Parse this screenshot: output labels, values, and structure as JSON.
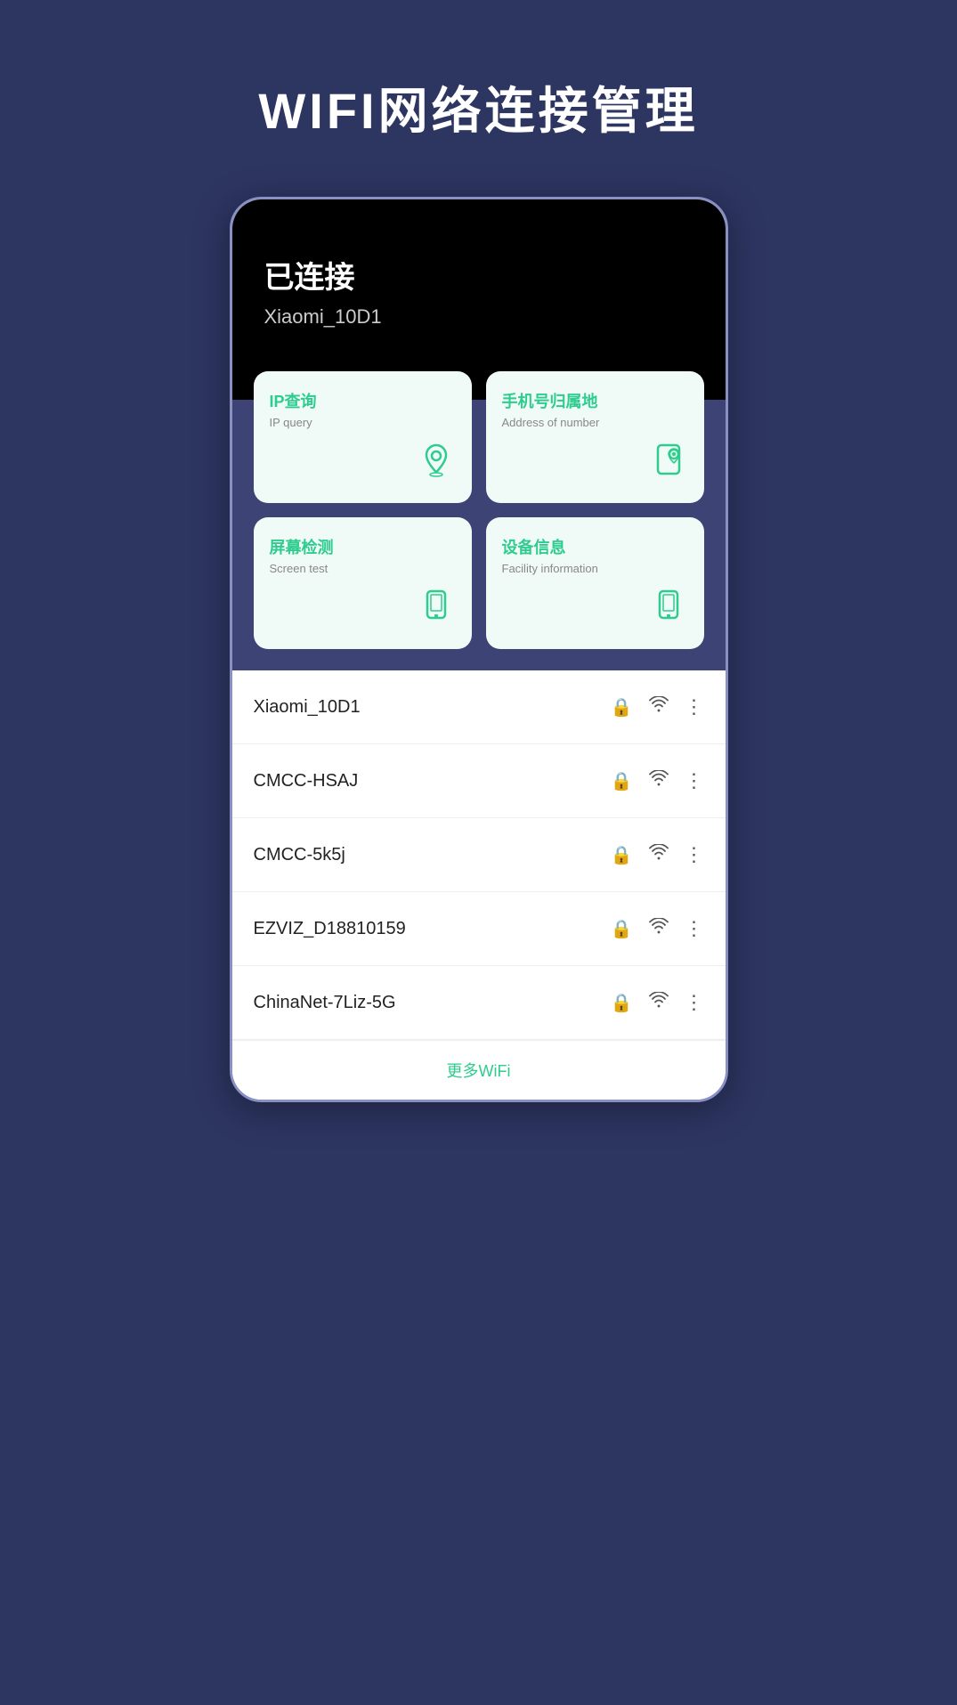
{
  "page": {
    "title": "WIFI网络连接管理"
  },
  "connected": {
    "label": "已连接",
    "ssid": "Xiaomi_10D1"
  },
  "feature_cards": [
    {
      "title_zh": "IP查询",
      "title_en": "IP query",
      "icon": "location"
    },
    {
      "title_zh": "手机号归属地",
      "title_en": "Address of number",
      "icon": "phone-location"
    },
    {
      "title_zh": "屏幕检测",
      "title_en": "Screen test",
      "icon": "screen"
    },
    {
      "title_zh": "设备信息",
      "title_en": "Facility information",
      "icon": "device"
    }
  ],
  "wifi_networks": [
    {
      "name": "Xiaomi_10D1"
    },
    {
      "name": "CMCC-HSAJ"
    },
    {
      "name": "CMCC-5k5j"
    },
    {
      "name": "EZVIZ_D18810159"
    },
    {
      "name": "ChinaNet-7Liz-5G"
    }
  ],
  "more_wifi_label": "更多WiFi"
}
